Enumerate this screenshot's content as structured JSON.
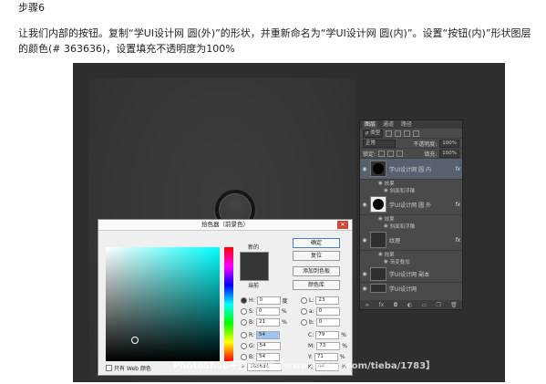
{
  "step_title": "步骤6",
  "description": "让我们内部的按钮。复制“学UI设计网 圆(外)”的形状，并重新命名为“学UI设计网 圆(内)”。设置“按钮(内)”形状图层的颜色(# 363636)，设置填充不透明度为100%",
  "colors": {
    "canvas": "#363636",
    "accent": "#4a7cc1"
  },
  "layers_panel": {
    "tabs": [
      "图层",
      "通道",
      "路径"
    ],
    "kind_label": "ρ 类型",
    "blend_mode": "正常",
    "opacity_label": "不透明度:",
    "opacity_value": "100%",
    "lock_label": "锁定:",
    "fill_label": "填充:",
    "fill_value": "100%",
    "layers": [
      {
        "name": "学UI设计网 圆 内",
        "fx": "fx",
        "effects_label": "效果",
        "effect": "斜面和浮雕",
        "selected": true
      },
      {
        "name": "学UI设计网 圆 外",
        "fx": "fx",
        "effects_label": "效果",
        "effect": "斜面和浮雕",
        "selected": false
      },
      {
        "name": "纹理",
        "fx": "fx",
        "effects_label": "效果",
        "effect": "渐变叠加",
        "selected": false
      },
      {
        "name": "学UI设计网 副本",
        "fx": "",
        "selected": false
      },
      {
        "name": "学UI设计网",
        "fx": "",
        "selected": false
      }
    ],
    "bottom_icons": [
      "link-icon",
      "fx-icon",
      "mask-icon",
      "adjust-icon",
      "folder-icon",
      "new-layer-icon",
      "trash-icon"
    ]
  },
  "color_picker": {
    "title": "拾色器（前景色）",
    "new_label": "新的",
    "current_label": "当前",
    "ok": "确定",
    "cancel": "复位",
    "add_swatch": "添加到色板",
    "libraries": "颜色库",
    "web_only": "只有 Web 颜色",
    "hex": "363636",
    "fields": {
      "H": {
        "value": "0",
        "unit": "度"
      },
      "S": {
        "value": "0",
        "unit": "%"
      },
      "B": {
        "value": "21",
        "unit": "%"
      },
      "R": {
        "value": "54"
      },
      "G": {
        "value": "54"
      },
      "Bv": {
        "value": "54"
      },
      "L": {
        "value": "23"
      },
      "a": {
        "value": "0"
      },
      "b": {
        "value": "0"
      },
      "C": {
        "value": "79",
        "unit": "%"
      },
      "M": {
        "value": "73",
        "unit": "%"
      },
      "Y": {
        "value": "71",
        "unit": "%"
      },
      "K": {
        "value": "44",
        "unit": "%"
      }
    }
  },
  "watermark": "PhotoShop平面设计吧【www.linecg.com/tieba/1783】"
}
